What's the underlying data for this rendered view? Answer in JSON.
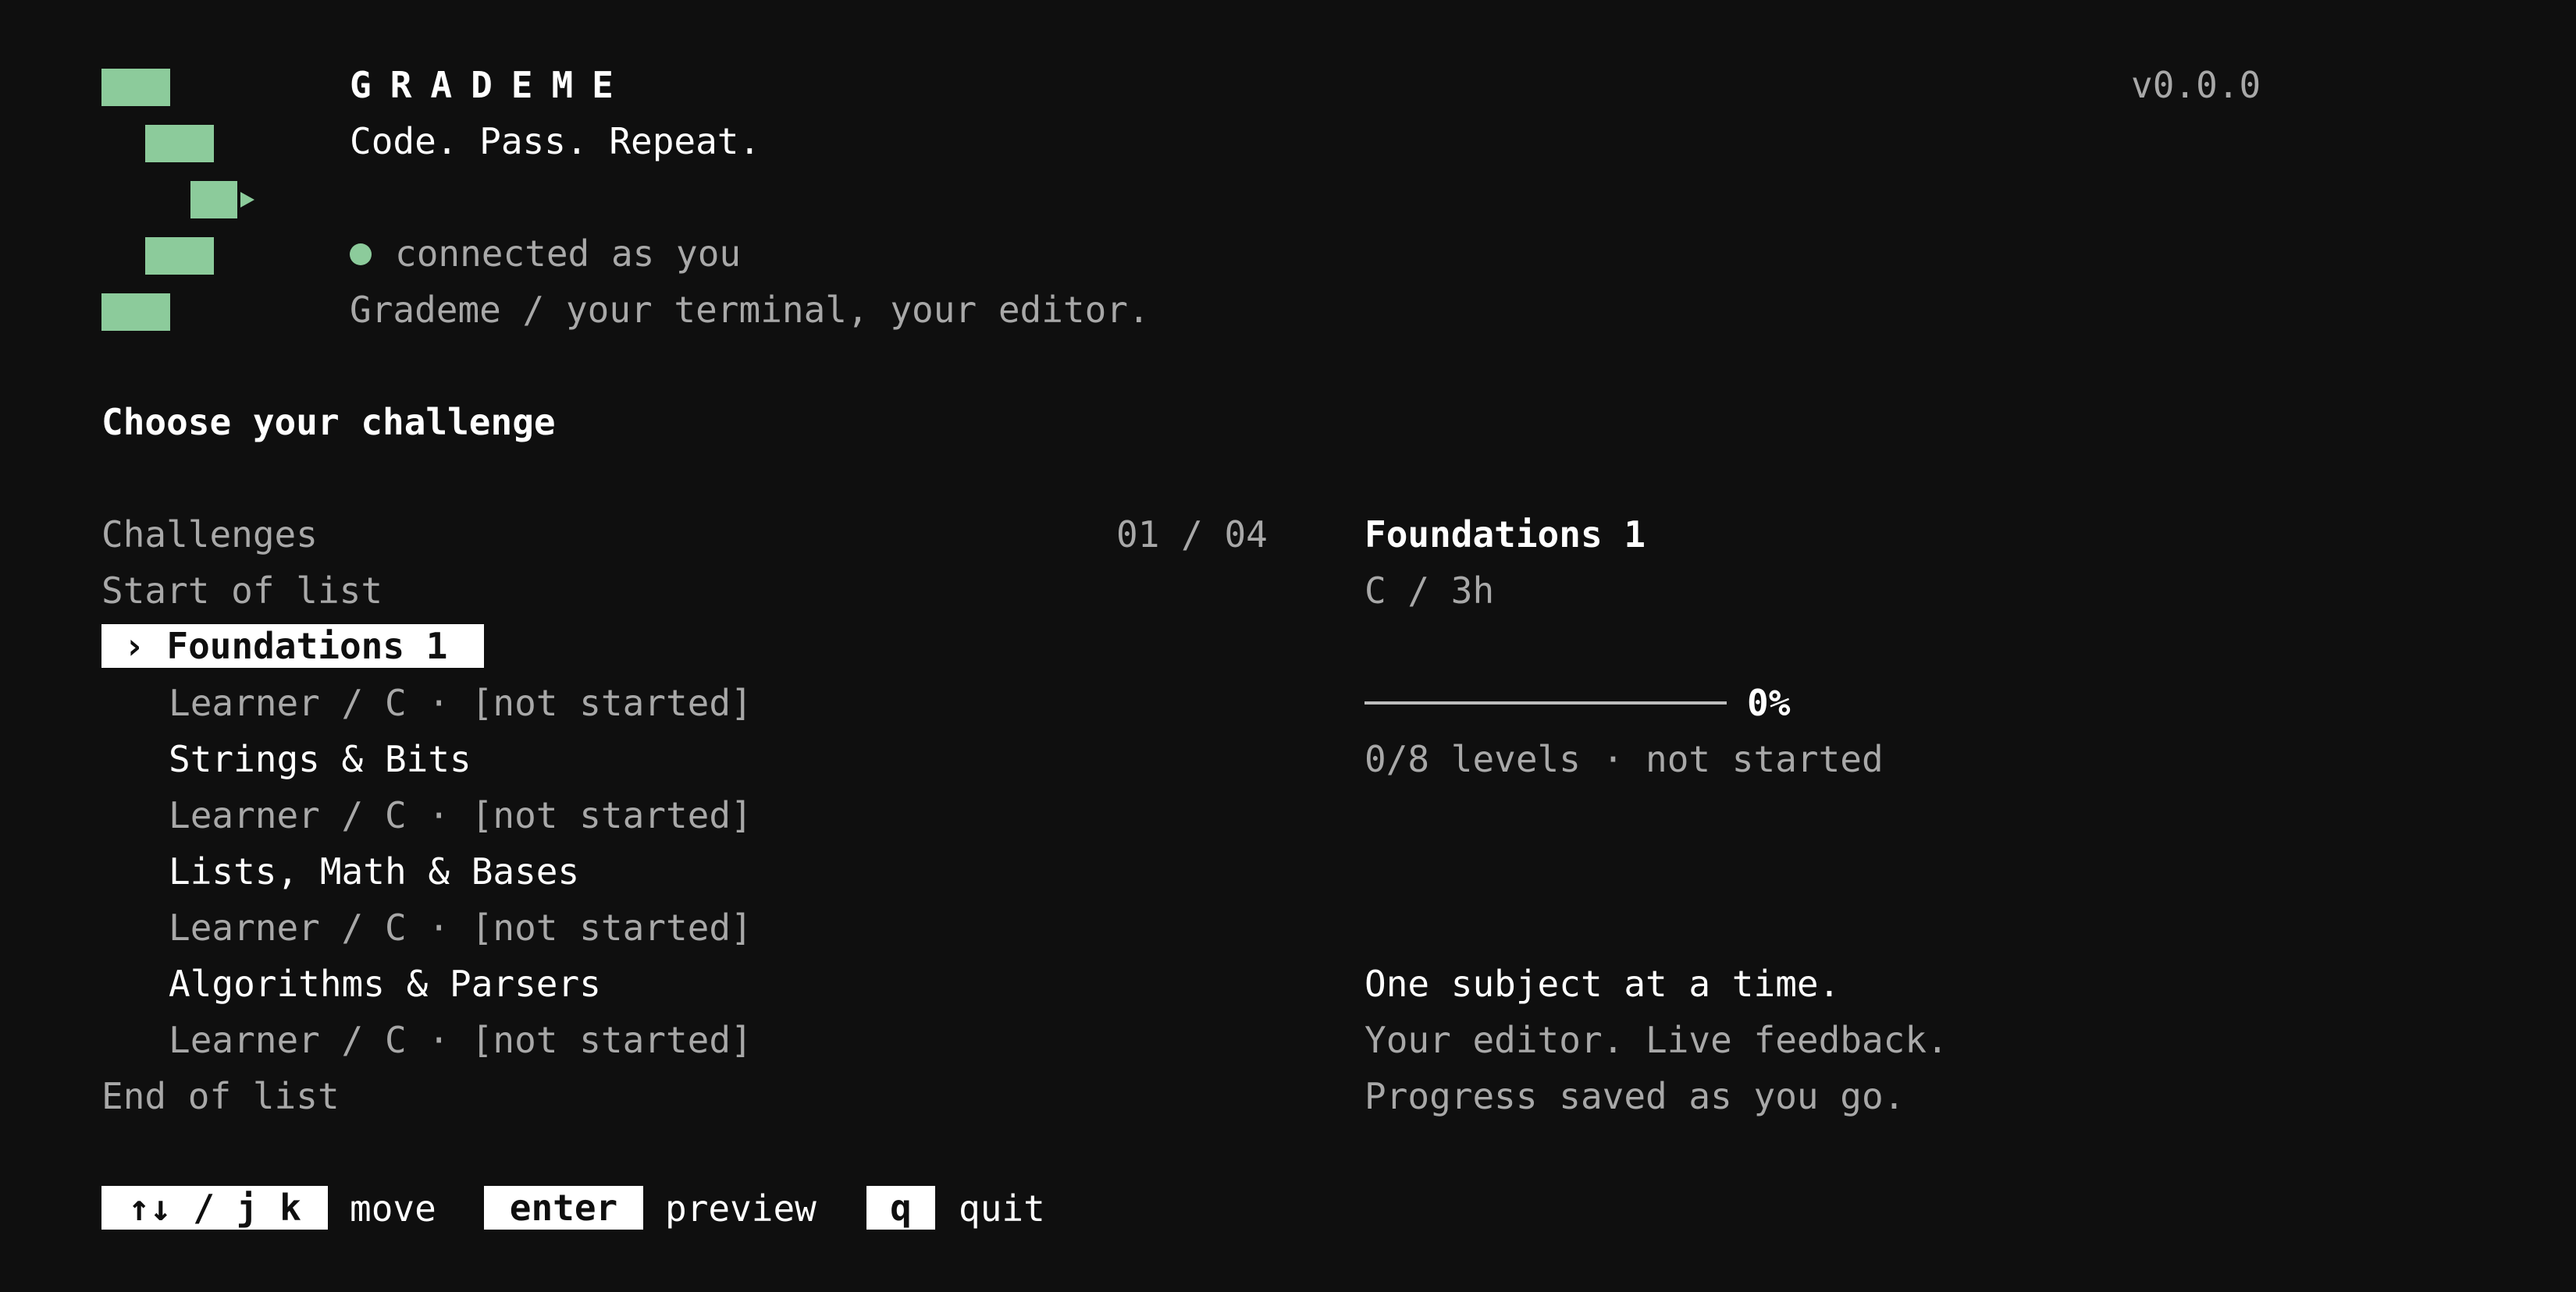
{
  "header": {
    "brand": "GRADEME",
    "tagline": "Code. Pass. Repeat.",
    "version": "v0.0.0",
    "status": "connected as you",
    "subtitle": "Grademe / your terminal, your editor."
  },
  "heading": "Choose your challenge",
  "list": {
    "title": "Challenges",
    "counter": "01 / 04",
    "start_marker": "Start of list",
    "end_marker": "End of list",
    "selected_prefix": "›",
    "items": [
      {
        "name": "Foundations 1",
        "meta": "Learner / C · [not started]"
      },
      {
        "name": "Strings & Bits",
        "meta": "Learner / C · [not started]"
      },
      {
        "name": "Lists, Math & Bases",
        "meta": "Learner / C · [not started]"
      },
      {
        "name": "Algorithms & Parsers",
        "meta": "Learner / C · [not started]"
      }
    ]
  },
  "detail": {
    "title": "Foundations 1",
    "meta": "C / 3h",
    "progress_percent": 0,
    "progress_label": "0%",
    "levels": "0/8 levels · not started",
    "blurb": [
      "One subject at a time.",
      "Your editor. Live feedback.",
      "Progress saved as you go."
    ]
  },
  "footer": {
    "keys": [
      {
        "key": "↑↓ / j k",
        "action": "move"
      },
      {
        "key": "enter",
        "action": "preview"
      },
      {
        "key": "q",
        "action": "quit"
      }
    ]
  },
  "colors": {
    "background": "#0f0f0f",
    "accent": "#8ccb9b",
    "text": "#ffffff",
    "muted": "#a8a8a8"
  }
}
